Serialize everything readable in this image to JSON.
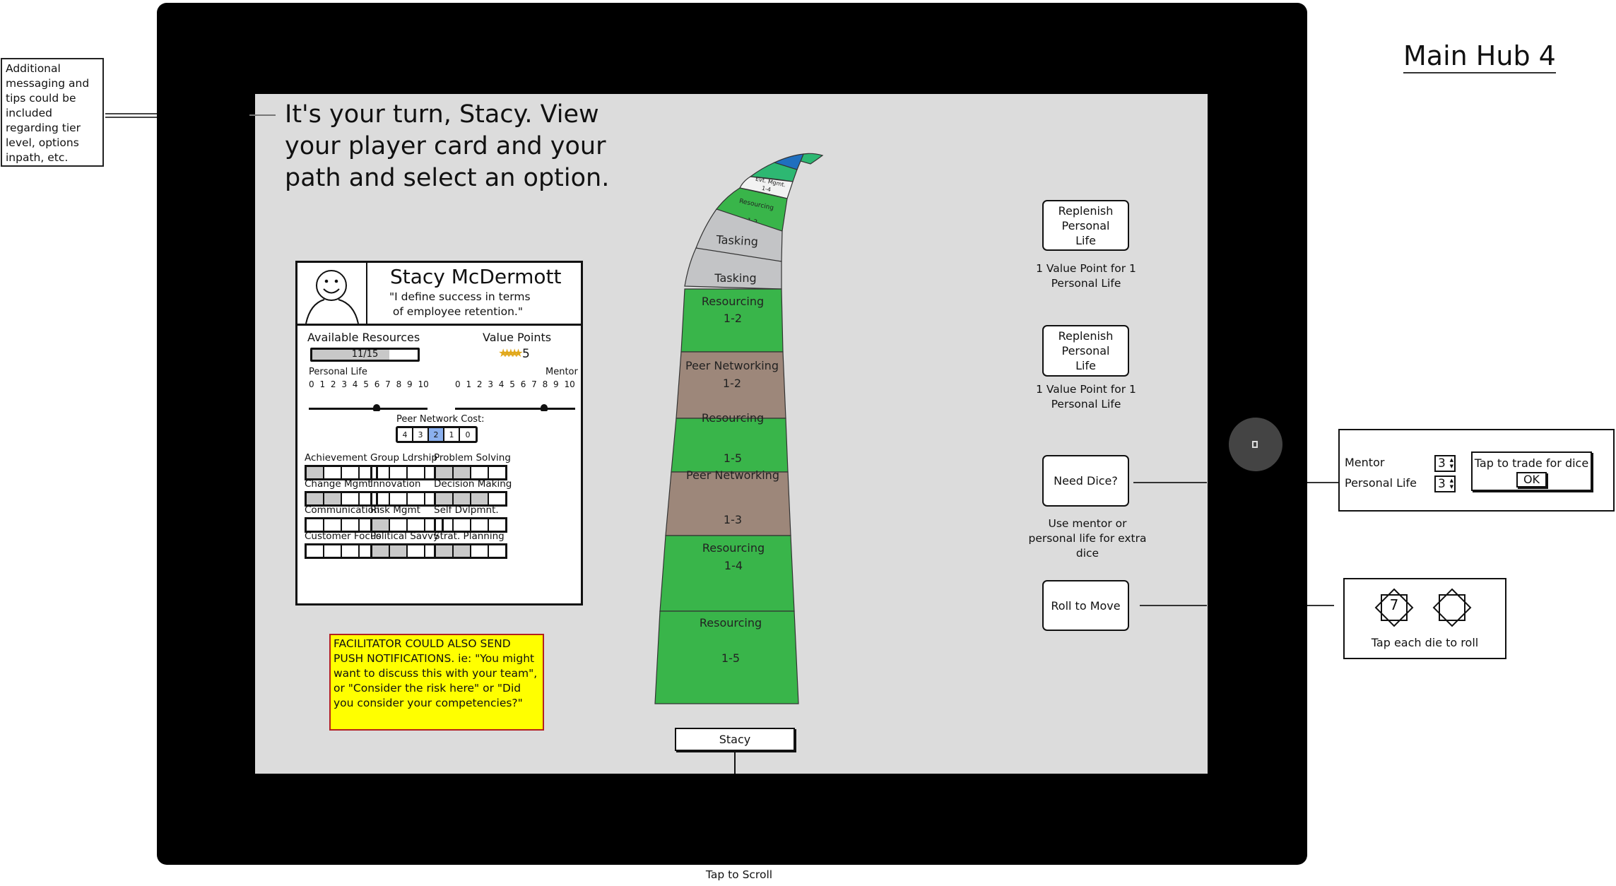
{
  "page_title": "Main Hub 4",
  "annotations": {
    "side_note": "Additional messaging and tips could be included regarding tier level, options inpath, etc.",
    "facilitator_note": "FACILITATOR COULD ALSO SEND PUSH NOTIFICATIONS. ie: \"You might want to discuss this with your team\", or \"Consider the risk here\" or \"Did you consider your competencies?\"",
    "tap_to_scroll": "Tap to Scroll"
  },
  "headline": "It's your turn, Stacy. View your player card and your path and select an option.",
  "player_card": {
    "name": "Stacy McDermott",
    "quote": "\"I define success in terms\n of employee retention.\"",
    "available_resources_label": "Available Resources",
    "available_resources_value": "11/15",
    "available_resources_fraction": 0.733,
    "value_points_label": "Value Points",
    "value_points": "5",
    "personal_life_label": "Personal Life",
    "personal_life_value": 6,
    "mentor_label": "Mentor",
    "mentor_value": 8,
    "scale_ticks": "0 1 2 3 4 5 6 7 8 9 10",
    "scale_max": 10,
    "peer_network_cost_label": "Peer Network Cost:",
    "peer_network_cost_options": [
      "4",
      "3",
      "2",
      "1",
      "0"
    ],
    "peer_network_cost_selected": "2",
    "competencies": [
      {
        "name": "Achievement",
        "level": 1,
        "max": 4
      },
      {
        "name": "Group Ldrship",
        "level": 0,
        "max": 4
      },
      {
        "name": "Problem Solving",
        "level": 2,
        "max": 4
      },
      {
        "name": "Change Mgmt",
        "level": 2,
        "max": 4
      },
      {
        "name": "Innovation",
        "level": 0,
        "max": 4
      },
      {
        "name": "Decision Making",
        "level": 3,
        "max": 4
      },
      {
        "name": "Communication",
        "level": 0,
        "max": 4
      },
      {
        "name": "Risk Mgmt",
        "level": 1,
        "max": 4
      },
      {
        "name": "Self Dvlpmnt.",
        "level": 0,
        "max": 4
      },
      {
        "name": "Customer Focus",
        "level": 0,
        "max": 4
      },
      {
        "name": "Political Savvy",
        "level": 2,
        "max": 4
      },
      {
        "name": "Strat. Planning",
        "level": 2,
        "max": 4
      }
    ]
  },
  "path": {
    "tiles_top_to_bottom": [
      {
        "label": "",
        "range": "",
        "color": "#2db872"
      },
      {
        "label": "",
        "range": "",
        "color": "#1f6fbf"
      },
      {
        "label": "",
        "range": "",
        "color": "#2db872"
      },
      {
        "label": "Evt. Mgmt.",
        "range": "1-4",
        "color": "#f2f2f2"
      },
      {
        "label": "Resourcing",
        "range": "1-2",
        "color": "#39b54a"
      },
      {
        "label": "Tasking",
        "range": "",
        "color": "#c3c4c6"
      },
      {
        "label": "Tasking",
        "range": "",
        "color": "#c3c4c6"
      },
      {
        "label": "Resourcing",
        "range": "1-2",
        "color": "#39b54a"
      },
      {
        "label": "Peer Networking",
        "range": "1-2",
        "color": "#9d877a"
      },
      {
        "label": "Resourcing",
        "range": "1-5",
        "color": "#39b54a"
      },
      {
        "label": "Peer Networking",
        "range": "1-3",
        "color": "#9d877a"
      },
      {
        "label": "Resourcing",
        "range": "1-4",
        "color": "#39b54a"
      },
      {
        "label": "Resourcing",
        "range": "1-5",
        "color": "#39b54a"
      }
    ],
    "player_marker": "Stacy"
  },
  "actions": {
    "replenish_1_label": "Replenish Personal Life",
    "replenish_1_caption": "1 Value Point for 1 Personal Life",
    "replenish_2_label": "Replenish Personal Life",
    "replenish_2_caption": "1 Value Point for 1 Personal Life",
    "need_dice_label": "Need Dice?",
    "need_dice_caption": "Use mentor or personal life for extra dice",
    "roll_label": "Roll to Move"
  },
  "trade_panel": {
    "mentor_label": "Mentor",
    "mentor_value": "3",
    "personal_life_label": "Personal Life",
    "personal_life_value": "3",
    "trade_text": "Tap to trade for dice",
    "ok_label": "OK"
  },
  "dice_panel": {
    "die_1_value": "7",
    "die_2_value": "",
    "caption": "Tap each die to roll"
  }
}
